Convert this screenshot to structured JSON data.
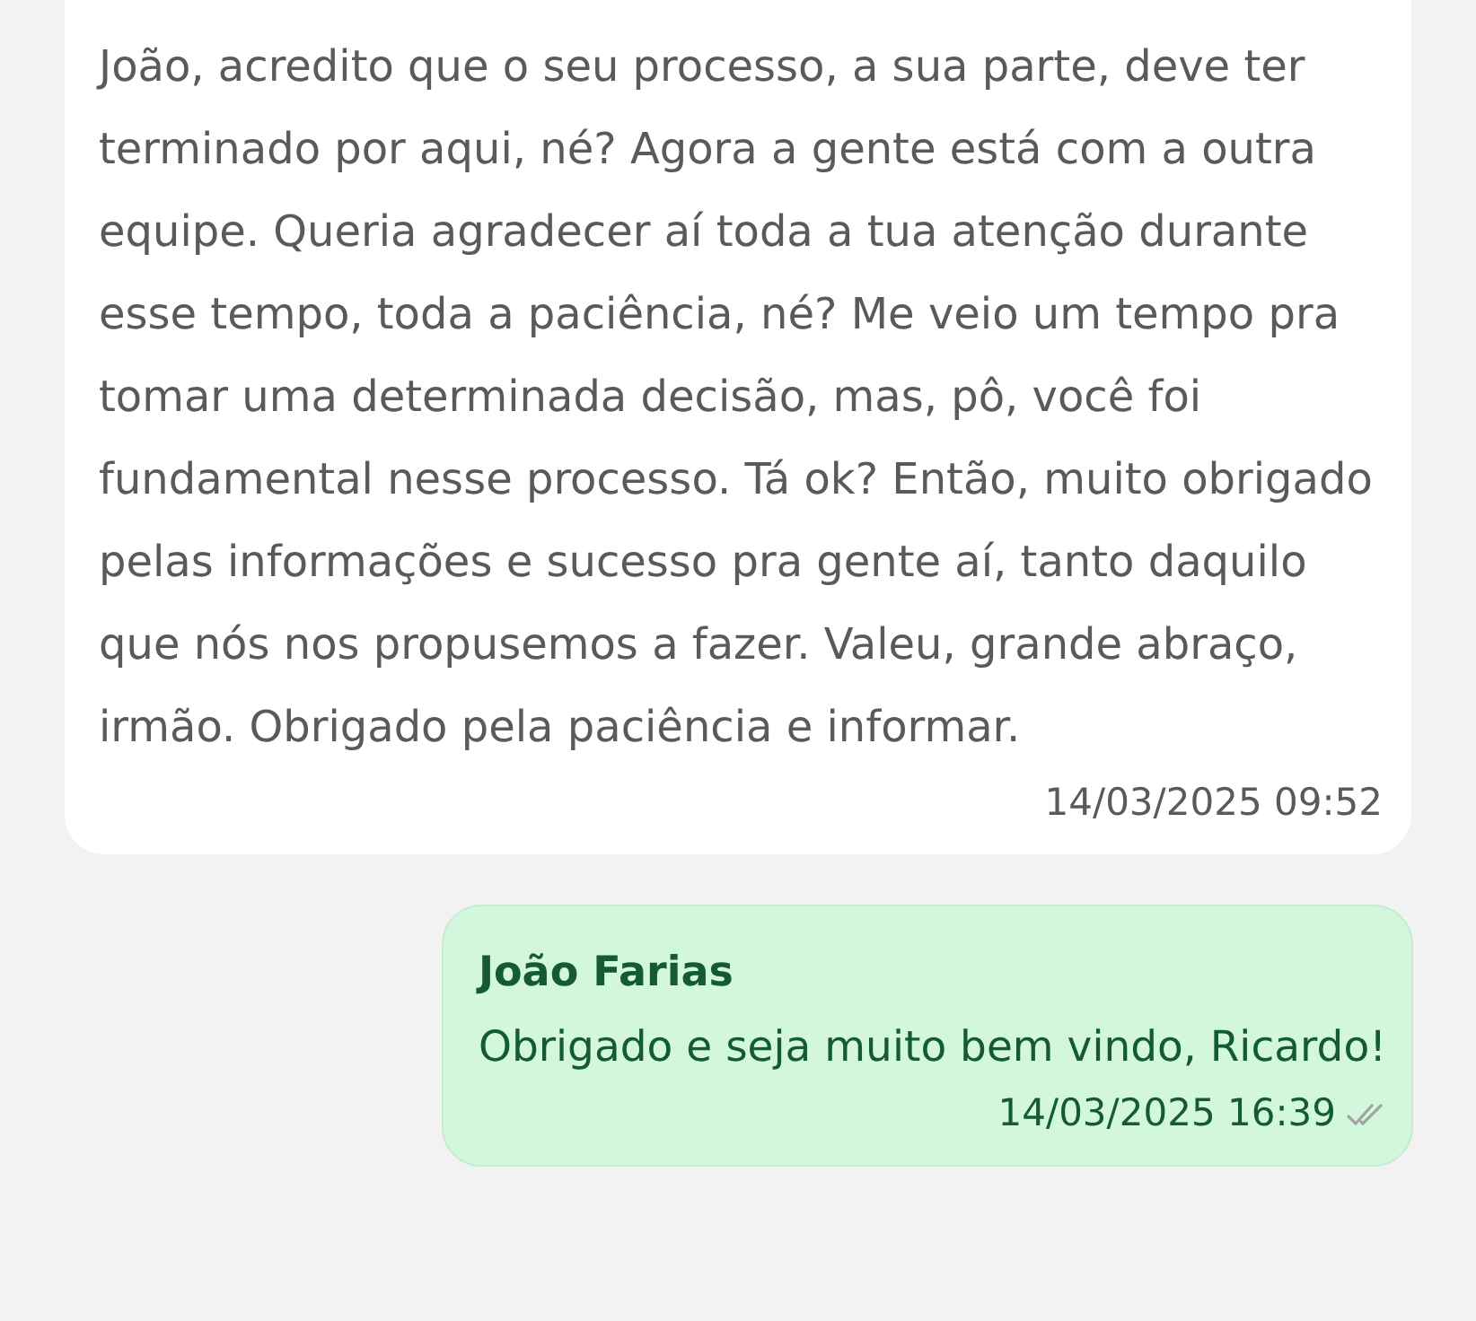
{
  "messages": [
    {
      "kind": "incoming",
      "text": "João, acredito que o seu processo, a sua parte, deve ter terminado por aqui, né? Agora a gente está com a outra equipe. Queria agradecer aí toda a tua atenção durante esse tempo, toda a paciência, né? Me veio um tempo pra tomar uma determinada decisão, mas, pô, você foi fundamental nesse processo. Tá ok? Então, muito obrigado pelas informações e sucesso pra gente aí, tanto daquilo que nós nos propusemos a fazer. Valeu, grande abraço, irmão. Obrigado pela paciência e informar.",
      "time": "14/03/2025 09:52"
    },
    {
      "kind": "outgoing",
      "sender": "João Farias",
      "text": "Obrigado e seja muito bem vindo, Ricardo!",
      "time": "14/03/2025 16:39",
      "read": false
    }
  ]
}
